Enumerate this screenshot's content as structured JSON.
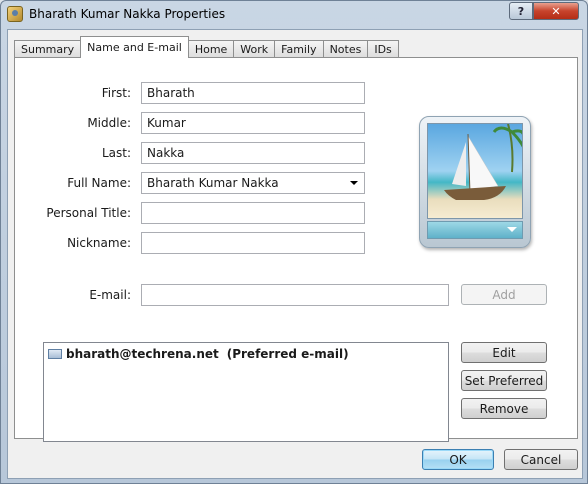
{
  "window": {
    "title": "Bharath Kumar Nakka Properties",
    "help_label": "?",
    "close_label": "✕"
  },
  "tabs": [
    {
      "label": "Summary"
    },
    {
      "label": "Name and E-mail"
    },
    {
      "label": "Home"
    },
    {
      "label": "Work"
    },
    {
      "label": "Family"
    },
    {
      "label": "Notes"
    },
    {
      "label": "IDs"
    }
  ],
  "form": {
    "first_label": "First:",
    "first_value": "Bharath",
    "middle_label": "Middle:",
    "middle_value": "Kumar",
    "last_label": "Last:",
    "last_value": "Nakka",
    "fullname_label": "Full Name:",
    "fullname_value": "Bharath Kumar Nakka",
    "title_label": "Personal Title:",
    "title_value": "",
    "nickname_label": "Nickname:",
    "nickname_value": "",
    "email_label": "E-mail:",
    "email_value": ""
  },
  "emails": [
    {
      "address": "bharath@techrena.net",
      "note": "(Preferred e-mail)"
    }
  ],
  "buttons": {
    "add": "Add",
    "edit": "Edit",
    "set_preferred": "Set Preferred",
    "remove": "Remove",
    "ok": "OK",
    "cancel": "Cancel"
  }
}
